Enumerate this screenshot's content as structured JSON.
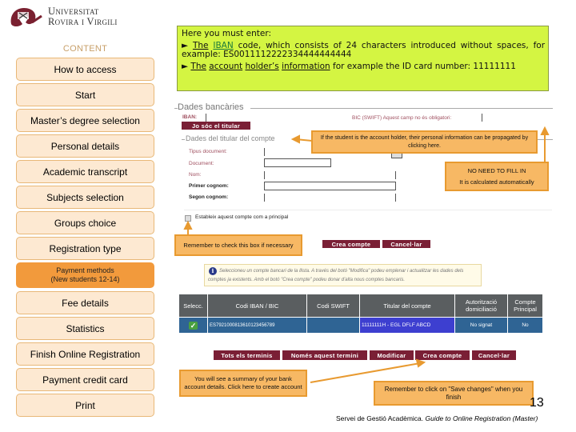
{
  "logo": {
    "line1": "Universitat",
    "line2": "Rovira i Virgili"
  },
  "sidebar": {
    "title": "CONTENT",
    "items": [
      {
        "label": "How to access"
      },
      {
        "label": "Start"
      },
      {
        "label": "Master’s degree selection"
      },
      {
        "label": "Personal details"
      },
      {
        "label": "Academic transcript"
      },
      {
        "label": "Subjects selection"
      },
      {
        "label": "Groups choice"
      },
      {
        "label": "Registration type"
      },
      {
        "label_line1": "Payment methods",
        "label_line2": "(New students 12-14)",
        "active": true
      },
      {
        "label": "Fee details"
      },
      {
        "label": "Statistics"
      },
      {
        "label": "Finish Online Registration"
      },
      {
        "label": "Payment credit card"
      },
      {
        "label": "Print"
      }
    ]
  },
  "instructions": {
    "intro": "Here you must enter:",
    "bullet": "►",
    "item1_the": "The",
    "item1_iban": "IBAN",
    "item1_rest": " code, which consists of 24 characters introduced without spaces, for example: ES0011112222334444444444",
    "item2_parts": [
      "The",
      "account",
      "holder’s",
      "information"
    ],
    "item2_rest": " for example the ID card number: 11111111"
  },
  "form": {
    "legend": "Dades bancàries",
    "iban_label": "IBAN:",
    "bic_label": "BIC (SWIFT) Aquest camp no és obligatori:",
    "holder_button": "Jo sóc el titular",
    "holder_legend": "Dades del titular del compte",
    "fields": [
      {
        "label": "Tipus document:"
      },
      {
        "label": "Document:"
      },
      {
        "label": "Nom:"
      },
      {
        "label": "Primer cognom:"
      },
      {
        "label": "Segon cognom:"
      }
    ],
    "checkbox_label": "Estableix aquest compte com a principal",
    "checkbox_checked": false,
    "create_button": "Crea compte",
    "cancel_button": "Cancel·lar"
  },
  "notice": {
    "icon": "i",
    "text": "Seleccioneu un compte bancari de la llista. A través del botó \"Modifica\" podeu emplenar i actualitzar les dades dels comptes ja existents. Amb el botó \"Crea compte\" podeu donar d'alta nous comptes bancaris."
  },
  "table": {
    "headers": [
      "Selecc.",
      "Codi IBAN / BIC",
      "Codi SWIFT",
      "Titular del compte",
      "Autorització domiciliació",
      "Compte Principal"
    ],
    "rows": [
      {
        "selected": true,
        "iban": "ES7921000813610123456789",
        "swift": "",
        "holder": "11111111H - EGL DFLF ABCD",
        "authorization": "No signat",
        "principal": "No"
      }
    ]
  },
  "actions": {
    "buttons": [
      "Tots els terminis",
      "Només aquest termini",
      "Modificar",
      "Crea compte",
      "Cancel·lar"
    ]
  },
  "callouts": {
    "holder": "If the student is the account holder, their personal information can be propagated by clicking here.",
    "no_need_title": "NO NEED TO FILL IN",
    "no_need_text": "It is calculated automatically",
    "checkbox": "Remember to check this box if necessary",
    "summary": "You will see a summary of your bank account details. Click here to create account",
    "save": "Remember to click on \"Save changes\" when you finish"
  },
  "page_number": "13",
  "footer": {
    "org": "Servei de Gestió Acadèmica. ",
    "title": "Guide to Online Registration (Master)"
  },
  "colors": {
    "nav_bg": "#fde9d2",
    "nav_border": "#e8b878",
    "nav_active": "#f29a3c",
    "instr_bg": "#d4f542",
    "maroon": "#7a1f35",
    "callout_bg": "#f7b864",
    "callout_border": "#e89a30",
    "table_header": "#5a5e60",
    "table_row": "#2f6494"
  }
}
